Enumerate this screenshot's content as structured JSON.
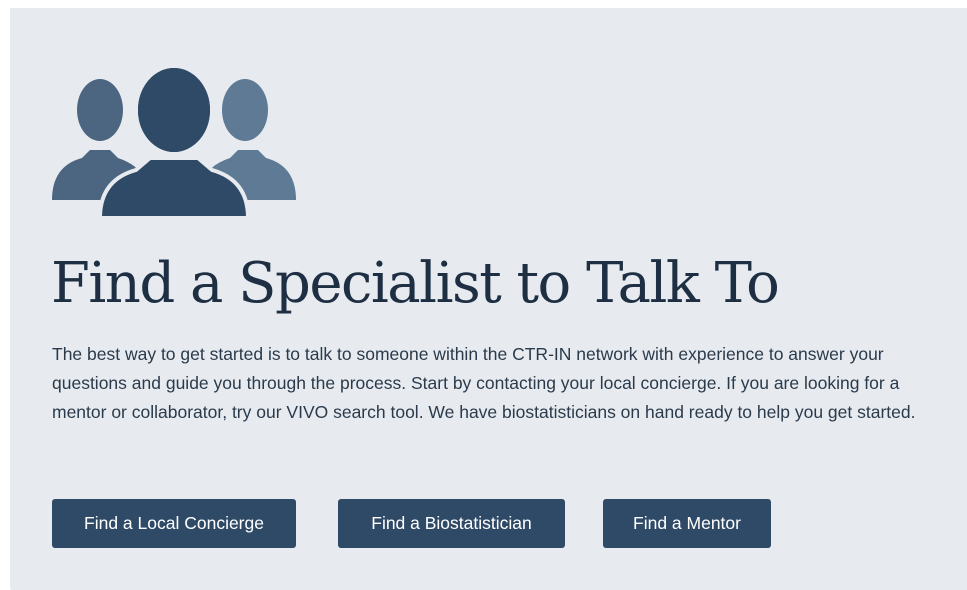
{
  "card": {
    "icon": "people-group-icon",
    "title": "Find a Specialist to Talk To",
    "description": "The best way to get started is to talk to someone within the CTR-IN network with experience to answer your questions and guide you through the process. Start by contacting your local concierge. If you are looking for a mentor or collaborator, try our VIVO search tool. We have biostatisticians on hand ready to help you get started.",
    "buttons": {
      "concierge": "Find a Local Concierge",
      "biostatistician": "Find a Biostatistician",
      "mentor": "Find a Mentor"
    }
  },
  "colors": {
    "background": "#e7ebf0",
    "heading": "#1e2f43",
    "button": "#2f4a67",
    "icon_front": "#2f4a67",
    "icon_left": "#4c6682",
    "icon_right": "#5e7a95"
  }
}
